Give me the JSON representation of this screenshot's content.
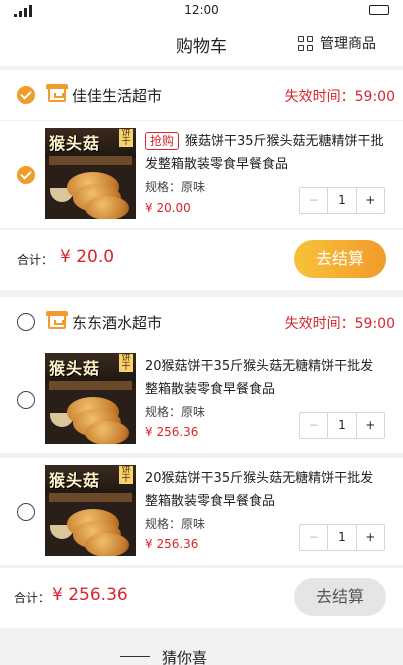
{
  "status_bar": {
    "time": "12:00"
  },
  "header": {
    "title": "购物车",
    "manage_label": "管理商品"
  },
  "stores": [
    {
      "name": "佳佳生活超市",
      "expire_label": "失效时间：",
      "expire_time": "59:00",
      "checked": true,
      "items": [
        {
          "badge": "抢购",
          "name": "猴菇饼干35斤猴头菇无糖精饼干批发整箱散装零食早餐食品",
          "spec": "规格：原味",
          "price": "¥ 20.00",
          "qty": "1",
          "checked": true
        }
      ],
      "total_label": "合计：",
      "total": "¥ 20.0",
      "checkout_label": "去结算"
    },
    {
      "name": "东东酒水超市",
      "expire_label": "失效时间：",
      "expire_time": "59:00",
      "checked": false,
      "items": [
        {
          "name": "20猴菇饼干35斤猴头菇无糖精饼干批发整箱散装零食早餐食品",
          "spec": "规格：原味",
          "price": "¥ 256.36",
          "qty": "1",
          "checked": false
        },
        {
          "name": "20猴菇饼干35斤猴头菇无糖精饼干批发整箱散装零食早餐食品",
          "spec": "规格：原味",
          "price": "¥ 256.36",
          "qty": "1",
          "checked": false
        }
      ],
      "total_label": "合计：",
      "total": "¥ 256.36",
      "checkout_label": "去结算"
    }
  ],
  "stepper": {
    "minus": "−",
    "plus": "+"
  },
  "product_image": {
    "title_text": "猴头菇",
    "tag_text": "饼干"
  },
  "footer": {
    "guess_label": "猜你喜"
  },
  "colors": {
    "accent": "#f29b2c",
    "price_red": "#d9262c"
  }
}
